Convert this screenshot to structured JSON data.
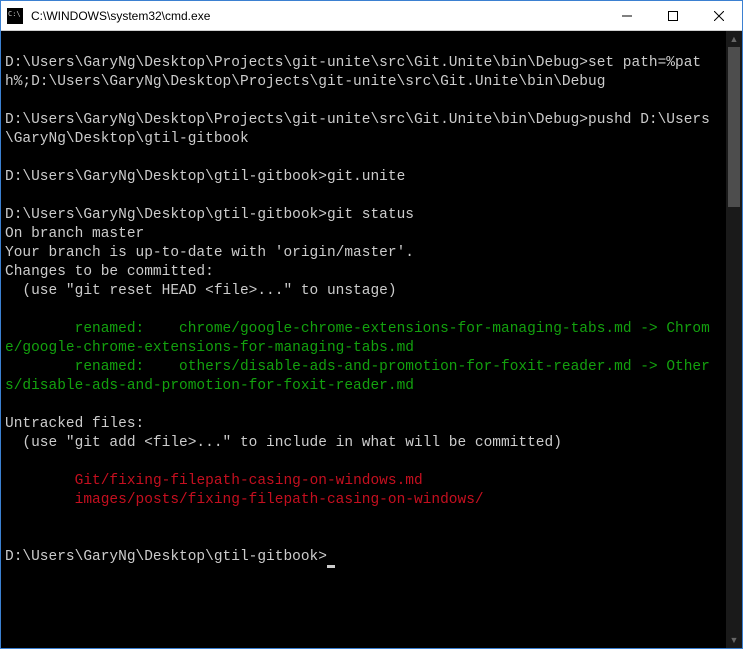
{
  "window": {
    "title": "C:\\WINDOWS\\system32\\cmd.exe"
  },
  "lines": [
    {
      "c": "w",
      "t": ""
    },
    {
      "c": "w",
      "t": "D:\\Users\\GaryNg\\Desktop\\Projects\\git-unite\\src\\Git.Unite\\bin\\Debug>set path=%path%;D:\\Users\\GaryNg\\Desktop\\Projects\\git-unite\\src\\Git.Unite\\bin\\Debug"
    },
    {
      "c": "w",
      "t": ""
    },
    {
      "c": "w",
      "t": "D:\\Users\\GaryNg\\Desktop\\Projects\\git-unite\\src\\Git.Unite\\bin\\Debug>pushd D:\\Users\\GaryNg\\Desktop\\gtil-gitbook"
    },
    {
      "c": "w",
      "t": ""
    },
    {
      "c": "w",
      "t": "D:\\Users\\GaryNg\\Desktop\\gtil-gitbook>git.unite"
    },
    {
      "c": "w",
      "t": ""
    },
    {
      "c": "w",
      "t": "D:\\Users\\GaryNg\\Desktop\\gtil-gitbook>git status"
    },
    {
      "c": "w",
      "t": "On branch master"
    },
    {
      "c": "w",
      "t": "Your branch is up-to-date with 'origin/master'."
    },
    {
      "c": "w",
      "t": "Changes to be committed:"
    },
    {
      "c": "w",
      "t": "  (use \"git reset HEAD <file>...\" to unstage)"
    },
    {
      "c": "w",
      "t": ""
    },
    {
      "c": "g",
      "t": "        renamed:    chrome/google-chrome-extensions-for-managing-tabs.md -> Chrome/google-chrome-extensions-for-managing-tabs.md"
    },
    {
      "c": "g",
      "t": "        renamed:    others/disable-ads-and-promotion-for-foxit-reader.md -> Others/disable-ads-and-promotion-for-foxit-reader.md"
    },
    {
      "c": "w",
      "t": ""
    },
    {
      "c": "w",
      "t": "Untracked files:"
    },
    {
      "c": "w",
      "t": "  (use \"git add <file>...\" to include in what will be committed)"
    },
    {
      "c": "w",
      "t": ""
    },
    {
      "c": "r",
      "t": "        Git/fixing-filepath-casing-on-windows.md"
    },
    {
      "c": "r",
      "t": "        images/posts/fixing-filepath-casing-on-windows/"
    },
    {
      "c": "w",
      "t": ""
    },
    {
      "c": "w",
      "t": ""
    },
    {
      "c": "w",
      "t": "D:\\Users\\GaryNg\\Desktop\\gtil-gitbook>",
      "cursor": true
    }
  ]
}
